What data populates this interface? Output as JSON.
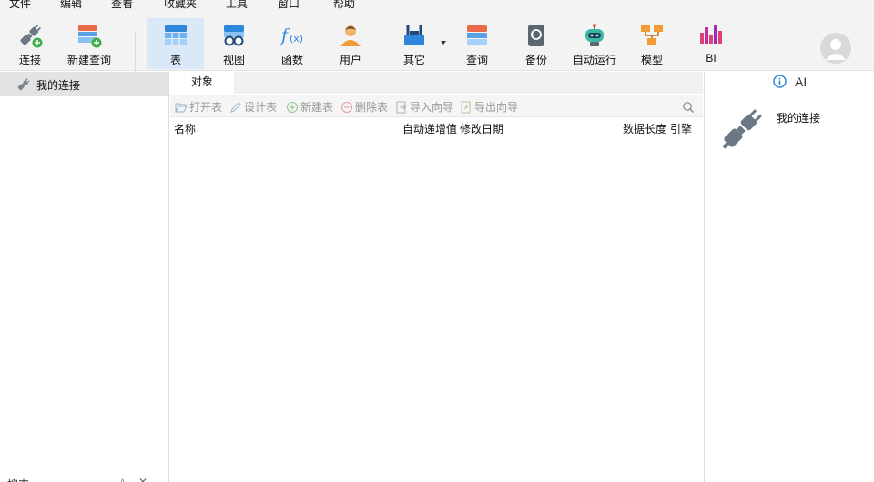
{
  "menu": [
    "文件",
    "编辑",
    "查看",
    "收藏夹",
    "工具",
    "窗口",
    "帮助"
  ],
  "toolbar": {
    "connect": "连接",
    "new_query": "新建查询",
    "table": "表",
    "view": "视图",
    "function": "函数",
    "user": "用户",
    "other": "其它",
    "query": "查询",
    "backup": "备份",
    "automation": "自动运行",
    "model": "模型",
    "bi": "BI"
  },
  "sidebar": {
    "connection": "我的连接",
    "search_label": "搜索"
  },
  "tabs": {
    "objects": "对象"
  },
  "object_toolbar": {
    "open_table": "打开表",
    "design_table": "设计表",
    "new_table": "新建表",
    "delete_table": "删除表",
    "import_wizard": "导入向导",
    "export_wizard": "导出向导"
  },
  "table_header": {
    "name": "名称",
    "auto_increment": "自动递增值",
    "modified_date": "修改日期",
    "data_length": "数据长度",
    "engine": "引擎"
  },
  "info_panel": {
    "ai_label": "AI",
    "connection_name": "我的连接"
  },
  "colors": {
    "accent": "#d9e9f8",
    "toolbar_bg": "#f3f3f3",
    "selected_item": "#e3e3e3"
  }
}
